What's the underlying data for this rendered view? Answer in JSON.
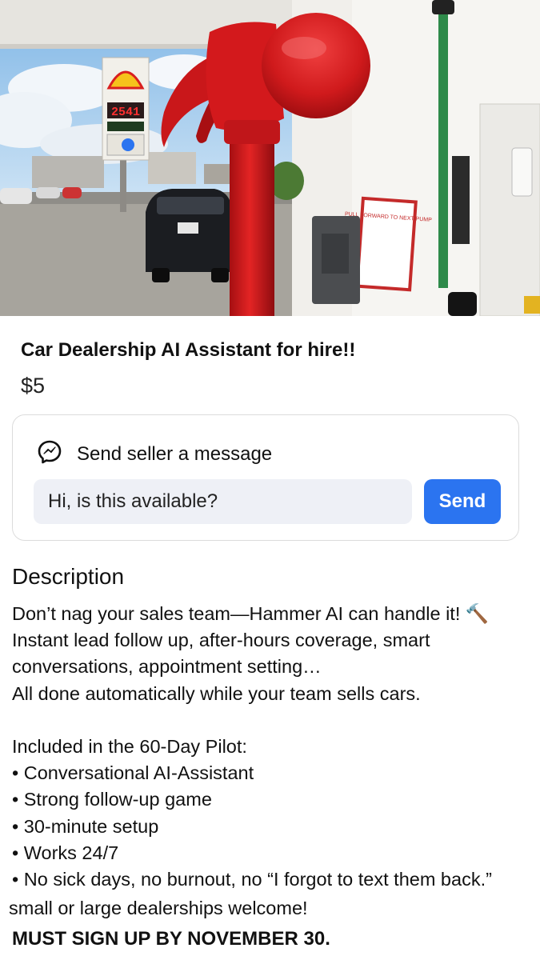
{
  "photo": {
    "alt": "Red hammer at a Shell gas station",
    "station_sign_price": "2541",
    "pump_sign": "PULL FORWARD TO NEXT PUMP"
  },
  "listing": {
    "title": "Car Dealership AI Assistant for hire!!",
    "price": "$5"
  },
  "message": {
    "heading": "Send seller a message",
    "input_value": "Hi, is this available?",
    "send_label": "Send"
  },
  "description": {
    "heading": "Description",
    "lines": [
      "Don’t nag your sales team—Hammer AI can handle it! 🔨",
      "Instant lead follow up, after-hours coverage, smart",
      "conversations, appointment setting…",
      "All done automatically while your team sells cars."
    ],
    "included_heading": "Included in the 60-Day Pilot:",
    "bullets": [
      "• Conversational AI-Assistant",
      "• Strong follow-up game",
      "• 30-minute setup",
      "• Works 24/7",
      "• No sick days, no burnout, no “I forgot to text them back.”"
    ],
    "closing": "small  or large dealerships welcome!",
    "cta": "MUST SIGN UP BY NOVEMBER 30."
  },
  "colors": {
    "send_button": "#2b74f0",
    "input_bg": "#eef0f6",
    "hammer_red": "#d81e1e"
  },
  "icons": {
    "messenger": "messenger-icon",
    "hammer": "hammer-emoji"
  }
}
